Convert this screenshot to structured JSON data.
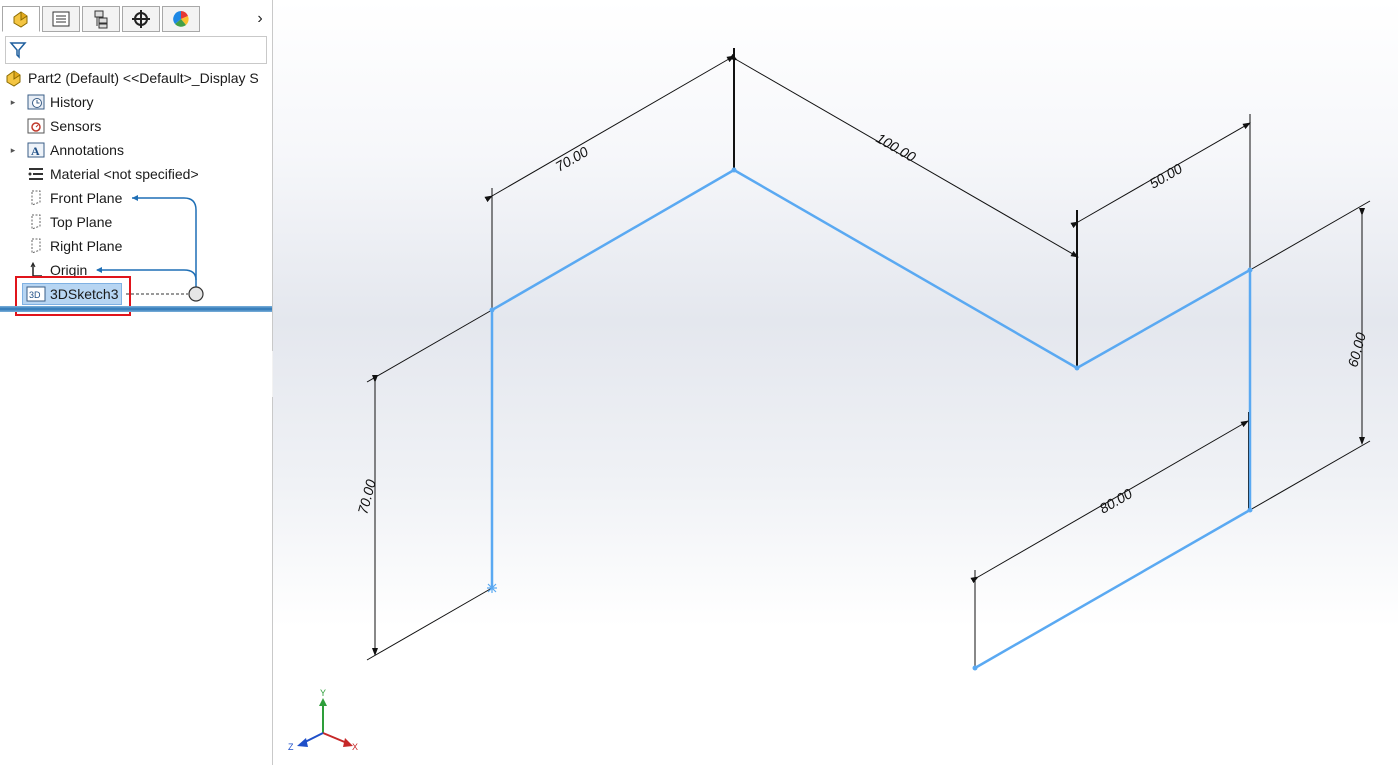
{
  "feature_tree": {
    "part_title": "Part2 (Default) <<Default>_Display S",
    "items": [
      {
        "label": "History",
        "icon": "history-icon"
      },
      {
        "label": "Sensors",
        "icon": "sensors-icon"
      },
      {
        "label": "Annotations",
        "icon": "annotations-icon"
      },
      {
        "label": "Material <not specified>",
        "icon": "material-icon"
      },
      {
        "label": "Front Plane",
        "icon": "plane-icon"
      },
      {
        "label": "Top Plane",
        "icon": "plane-icon"
      },
      {
        "label": "Right Plane",
        "icon": "plane-icon"
      },
      {
        "label": "Origin",
        "icon": "origin-icon"
      },
      {
        "label": "3DSketch3",
        "icon": "3d-sketch-icon",
        "badge": "3D"
      }
    ]
  },
  "tabs": [
    "featuremanager",
    "propertymanager",
    "configurationmanager",
    "dimxpertmanager",
    "displaymanager"
  ],
  "dimensions": {
    "d1": "70.00",
    "d2": "100.00",
    "d3": "50.00",
    "d4": "60.00",
    "d5": "80.00",
    "d6": "70.00"
  },
  "triad": {
    "x": "X",
    "y": "Y",
    "z": "Z"
  },
  "colors": {
    "sketch": "#5aa9f2",
    "dimension": "#111111",
    "highlight": "#e0141b",
    "selection": "#b7d5f2"
  }
}
